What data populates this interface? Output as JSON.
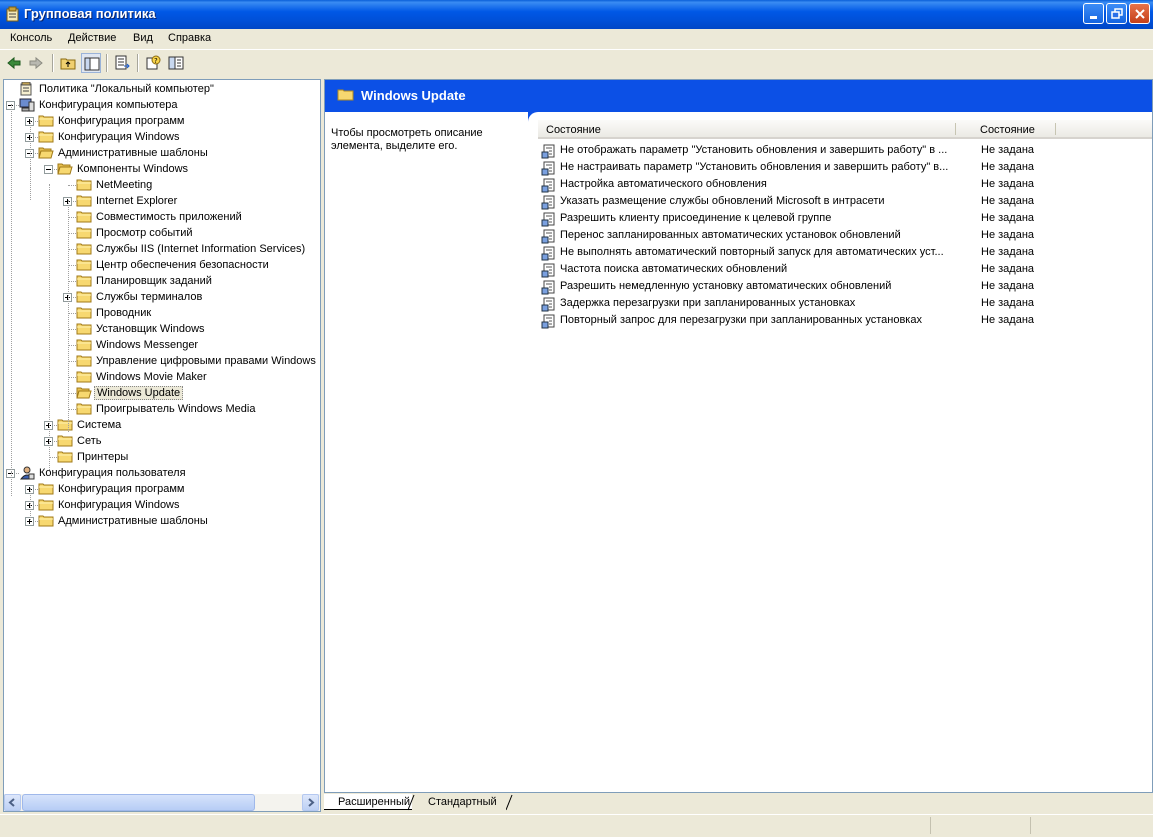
{
  "window": {
    "title": "Групповая политика"
  },
  "menu": [
    "Консоль",
    "Действие",
    "Вид",
    "Справка"
  ],
  "toolbar": {
    "buttons": [
      "back-icon",
      "forward-icon",
      "up-folder-icon",
      "show-hide-tree-icon",
      "export-list-icon",
      "help-icon",
      "properties-icon"
    ]
  },
  "tree": {
    "root": "Политика \"Локальный компьютер\"",
    "computer_config": "Конфигурация компьютера",
    "cc_programs": "Конфигурация программ",
    "cc_windows": "Конфигурация Windows",
    "cc_admin": "Административные шаблоны",
    "windows_components": "Компоненты Windows",
    "components": [
      "NetMeeting",
      "Internet Explorer",
      "Совместимость приложений",
      "Просмотр событий",
      "Службы IIS (Internet Information Services)",
      "Центр обеспечения безопасности",
      "Планировщик заданий",
      "Службы терминалов",
      "Проводник",
      "Установщик Windows",
      "Windows Messenger",
      "Управление цифровыми правами Windows",
      "Windows Movie Maker",
      "Windows Update",
      "Проигрыватель Windows Media"
    ],
    "system": "Система",
    "network": "Сеть",
    "printers": "Принтеры",
    "user_config": "Конфигурация пользователя",
    "uc_programs": "Конфигурация программ",
    "uc_windows": "Конфигурация Windows",
    "uc_admin": "Административные шаблоны"
  },
  "details": {
    "title": "Windows Update",
    "description": "Чтобы просмотреть описание элемента, выделите его.",
    "columns": [
      "Состояние",
      "Состояние"
    ],
    "rows": [
      {
        "name": "Не отображать параметр \"Установить обновления и завершить работу\" в ...",
        "state": "Не задана"
      },
      {
        "name": "Не настраивать параметр \"Установить обновления и завершить работу\" в...",
        "state": "Не задана"
      },
      {
        "name": "Настройка автоматического обновления",
        "state": "Не задана"
      },
      {
        "name": "Указать размещение службы обновлений Microsoft в интрасети",
        "state": "Не задана"
      },
      {
        "name": "Разрешить клиенту присоединение к целевой группе",
        "state": "Не задана"
      },
      {
        "name": "Перенос запланированных автоматических установок обновлений",
        "state": "Не задана"
      },
      {
        "name": "Не выполнять автоматический повторный запуск для автоматических уст...",
        "state": "Не задана"
      },
      {
        "name": "Частота поиска автоматических обновлений",
        "state": "Не задана"
      },
      {
        "name": "Разрешить немедленную установку автоматических обновлений",
        "state": "Не задана"
      },
      {
        "name": "Задержка перезагрузки при запланированных установках",
        "state": "Не задана"
      },
      {
        "name": "Повторный запрос для перезагрузки при запланированных установках",
        "state": "Не задана"
      }
    ]
  },
  "tabs": [
    "Расширенный",
    "Стандартный"
  ]
}
